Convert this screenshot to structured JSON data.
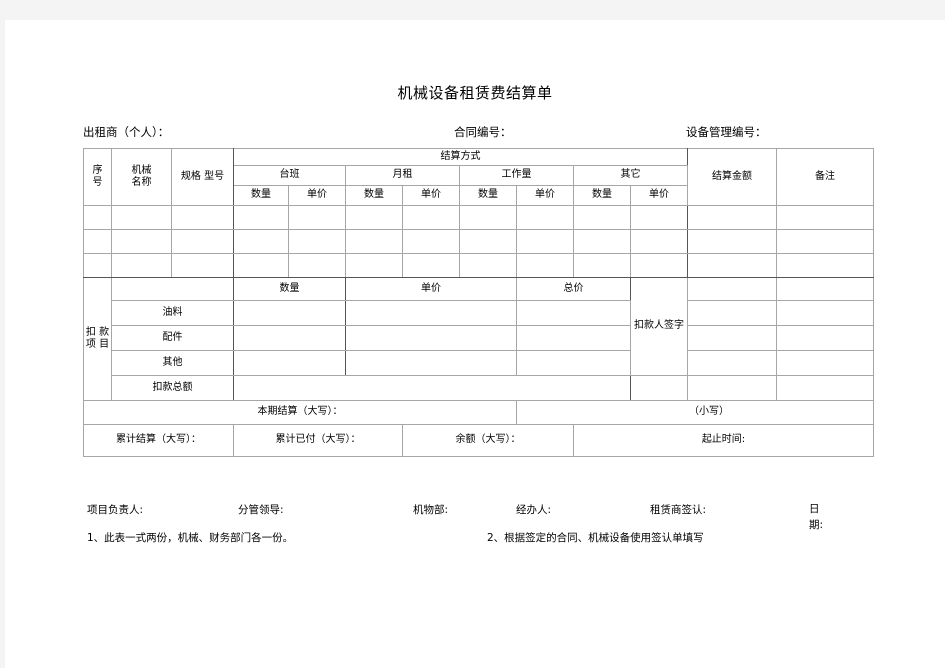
{
  "document": {
    "title": "机械设备租赁费结算单"
  },
  "header": {
    "lessor_label": "出租商（个人）：",
    "contract_no_label": "合同编号：",
    "equipment_no_label": "设备管理编号："
  },
  "table": {
    "columns": {
      "seq": "序\n号",
      "seq_line1": "序",
      "seq_line2": "号",
      "machine_name_line1": "机械",
      "machine_name_line2": "名称",
      "spec_model": "规格 型号",
      "settlement_method": "结算方式",
      "settlement_amount": "结算金额",
      "remark": "备注"
    },
    "method_groups": [
      {
        "name": "台班",
        "sub": [
          "数量",
          "单价"
        ]
      },
      {
        "name": "月租",
        "sub": [
          "数量",
          "单价"
        ]
      },
      {
        "name": "工作量",
        "sub": [
          "数量",
          "单价"
        ]
      },
      {
        "name": "其它",
        "sub": [
          "数量",
          "单价"
        ]
      }
    ],
    "data_rows": [
      {
        "seq": "",
        "machine_name": "",
        "spec_model": "",
        "values": [
          "",
          "",
          "",
          "",
          "",
          "",
          "",
          ""
        ],
        "amount": "",
        "remark": ""
      },
      {
        "seq": "",
        "machine_name": "",
        "spec_model": "",
        "values": [
          "",
          "",
          "",
          "",
          "",
          "",
          "",
          ""
        ],
        "amount": "",
        "remark": ""
      },
      {
        "seq": "",
        "machine_name": "",
        "spec_model": "",
        "values": [
          "",
          "",
          "",
          "",
          "",
          "",
          "",
          ""
        ],
        "amount": "",
        "remark": ""
      }
    ],
    "deduction": {
      "label_line1": "扣 款",
      "label_line2": "项 目",
      "head_qty": "数量",
      "head_price": "单价",
      "head_total": "总价",
      "head_signature": "扣款人签字",
      "items": [
        {
          "name": "油料",
          "qty": "",
          "price": "",
          "total": "",
          "amount": "",
          "remark": ""
        },
        {
          "name": "配件",
          "qty": "",
          "price": "",
          "total": "",
          "amount": "",
          "remark": ""
        },
        {
          "name": "其他",
          "qty": "",
          "price": "",
          "total": "",
          "amount": "",
          "remark": ""
        }
      ],
      "total_row": {
        "name": "扣款总额",
        "value": "",
        "amount": "",
        "remark": ""
      }
    },
    "summary": {
      "current_settlement_label": "本期结算（大写）：",
      "current_settlement_value": "",
      "lowercase_label": "（小写）",
      "lowercase_value": "",
      "cumulative_settlement_label": "累计结算（大写）：",
      "cumulative_settlement_value": "",
      "cumulative_paid_label": "累计已付（大写）：",
      "cumulative_paid_value": "",
      "balance_label": "余额（大写）：",
      "balance_value": "",
      "period_label": "起止时间:",
      "period_value": ""
    }
  },
  "signatures": {
    "project_leader": "项目负责人:",
    "supervising_leader": "分管领导:",
    "equipment_dept": "机物部:",
    "handler": "经办人:",
    "lessor_confirm": "租赁商签认:",
    "date": "日期:"
  },
  "footnotes": {
    "note1": "1、此表一式两份，机械、财务部门各一份。",
    "note2": "2、根据签定的合同、机械设备使用签认单填写"
  }
}
